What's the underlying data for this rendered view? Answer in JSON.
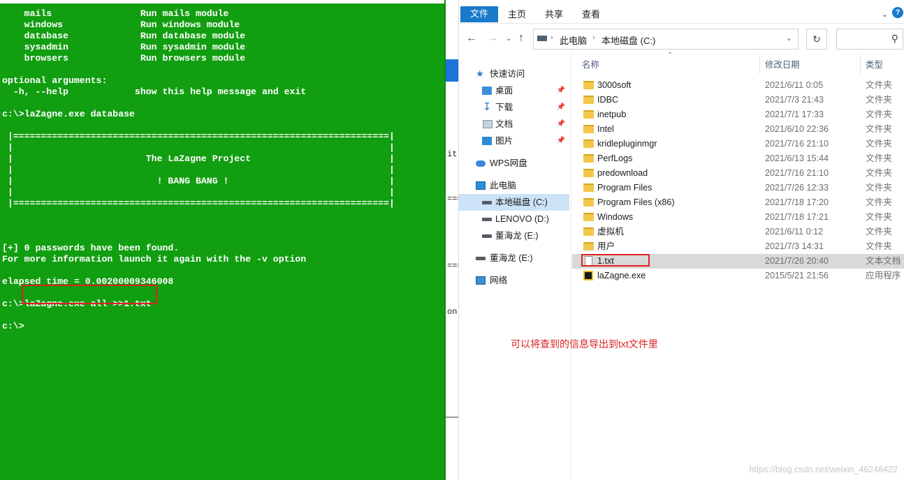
{
  "console": {
    "lines": [
      "    mails                Run mails module",
      "    windows              Run windows module",
      "    database             Run database module",
      "    sysadmin             Run sysadmin module",
      "    browsers             Run browsers module",
      "",
      "optional arguments:",
      "  -h, --help            show this help message and exit",
      "",
      "c:\\>laZagne.exe database",
      "",
      " |====================================================================|",
      " |                                                                    |",
      " |                        The LaZagne Project                         |",
      " |                                                                    |",
      " |                          ! BANG BANG !                             |",
      " |                                                                    |",
      " |====================================================================|",
      "",
      "",
      "",
      "[+] 0 passwords have been found.",
      "For more information launch it again with the -v option",
      "",
      "elapsed time = 0.00200009346008",
      "",
      "c:\\>laZagne.exe all >>1.txt",
      "",
      "c:\\>"
    ]
  },
  "behind_window": {
    "fragments": [
      "it",
      "===",
      "===",
      "on"
    ]
  },
  "explorer": {
    "ribbon_tabs": [
      "文件",
      "主页",
      "共享",
      "查看"
    ],
    "ribbon_expand_icon": "chevron-down",
    "help_label": "?",
    "address": {
      "segments": [
        "此电脑",
        "本地磁盘 (C:)"
      ]
    },
    "search_placeholder": "",
    "nav_items": [
      {
        "label": "快速访问",
        "icon": "star",
        "pinned": false
      },
      {
        "label": "桌面",
        "icon": "desktop",
        "pinned": true
      },
      {
        "label": "下载",
        "icon": "download",
        "pinned": true
      },
      {
        "label": "文档",
        "icon": "document",
        "pinned": true
      },
      {
        "label": "图片",
        "icon": "picture",
        "pinned": true
      },
      {
        "label": "WPS网盘",
        "icon": "cloud",
        "pinned": false
      },
      {
        "label": "此电脑",
        "icon": "computer",
        "pinned": false
      },
      {
        "label": "本地磁盘 (C:)",
        "icon": "drive",
        "pinned": false,
        "selected": true
      },
      {
        "label": "LENOVO (D:)",
        "icon": "drive",
        "pinned": false
      },
      {
        "label": "董海龙 (E:)",
        "icon": "drive",
        "pinned": false
      },
      {
        "label": "董海龙 (E:)",
        "icon": "drive",
        "pinned": false
      },
      {
        "label": "网络",
        "icon": "network",
        "pinned": false
      }
    ],
    "columns": [
      "名称",
      "修改日期",
      "类型"
    ],
    "files": [
      {
        "name": "3000soft",
        "date": "2021/6/11 0:05",
        "type": "文件夹",
        "kind": "folder"
      },
      {
        "name": "IDBC",
        "date": "2021/7/3 21:43",
        "type": "文件夹",
        "kind": "folder"
      },
      {
        "name": "inetpub",
        "date": "2021/7/1 17:33",
        "type": "文件夹",
        "kind": "folder"
      },
      {
        "name": "Intel",
        "date": "2021/6/10 22:36",
        "type": "文件夹",
        "kind": "folder"
      },
      {
        "name": "kridlepluginmgr",
        "date": "2021/7/16 21:10",
        "type": "文件夹",
        "kind": "folder"
      },
      {
        "name": "PerfLogs",
        "date": "2021/6/13 15:44",
        "type": "文件夹",
        "kind": "folder"
      },
      {
        "name": "predownload",
        "date": "2021/7/16 21:10",
        "type": "文件夹",
        "kind": "folder"
      },
      {
        "name": "Program Files",
        "date": "2021/7/26 12:33",
        "type": "文件夹",
        "kind": "folder"
      },
      {
        "name": "Program Files (x86)",
        "date": "2021/7/18 17:20",
        "type": "文件夹",
        "kind": "folder"
      },
      {
        "name": "Windows",
        "date": "2021/7/18 17:21",
        "type": "文件夹",
        "kind": "folder"
      },
      {
        "name": "虚拟机",
        "date": "2021/6/11 0:12",
        "type": "文件夹",
        "kind": "folder"
      },
      {
        "name": "用户",
        "date": "2021/7/3 14:31",
        "type": "文件夹",
        "kind": "folder"
      },
      {
        "name": "1.txt",
        "date": "2021/7/26 20:40",
        "type": "文本文档",
        "kind": "text",
        "selected": true
      },
      {
        "name": "laZagne.exe",
        "date": "2015/5/21 21:56",
        "type": "应用程序",
        "kind": "exe"
      }
    ]
  },
  "annotation": "可以将查到的信息导出到txt文件里",
  "watermark": "https://blog.csdn.net/weixin_46248422",
  "colors": {
    "console_bg": "#119e11",
    "console_text": "#ffffff",
    "highlight": "#e02020",
    "accent": "#1979ca",
    "selected_row": "#d9d9d9",
    "selected_nav": "#cce3f7"
  }
}
